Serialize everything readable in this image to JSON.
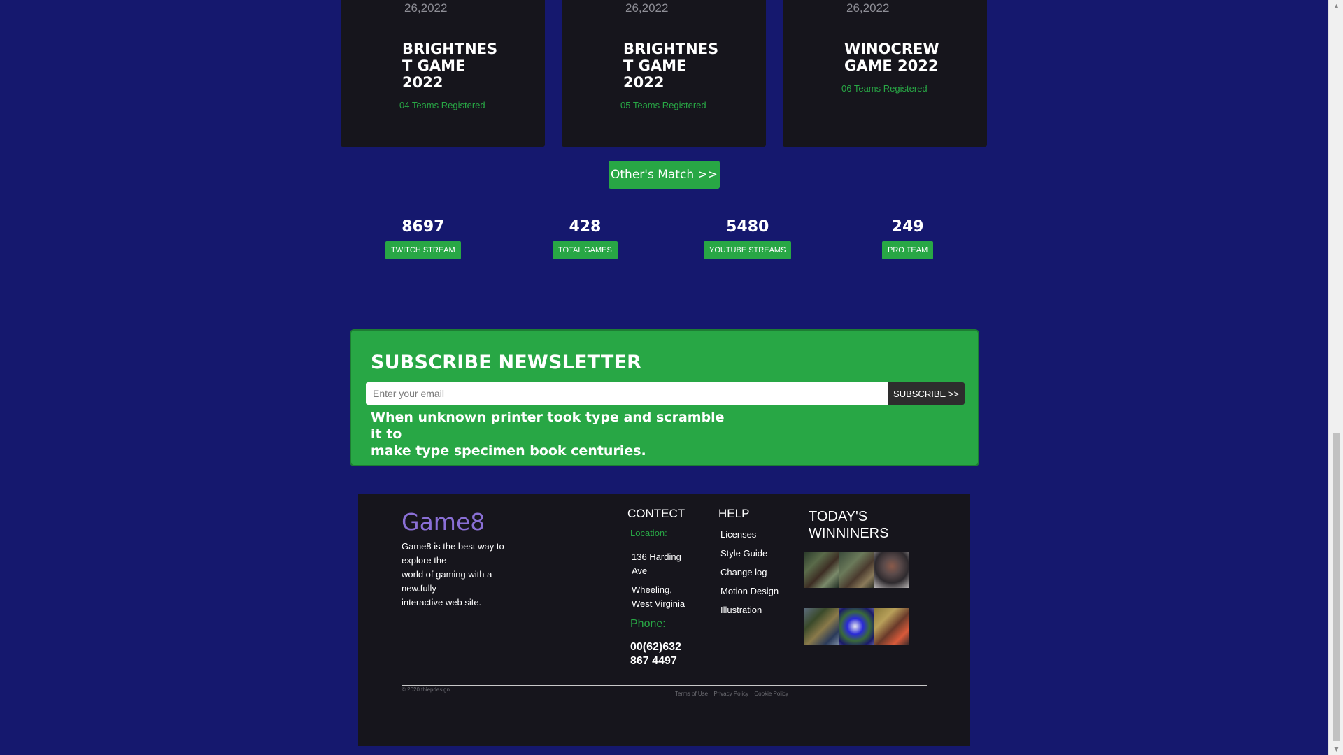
{
  "matches": [
    {
      "date": "26,2022",
      "title_lines": [
        "BRIGHTNES",
        "T GAME",
        "2022"
      ],
      "teams": "04 Teams Registered"
    },
    {
      "date": "26,2022",
      "title_lines": [
        "BRIGHTNES",
        "T GAME",
        "2022"
      ],
      "teams": "05 Teams Registered"
    },
    {
      "date": "26,2022",
      "title_lines": [
        "WINOCREW",
        "GAME 2022"
      ],
      "teams": "06 Teams Registered"
    }
  ],
  "others_button": "Other's Match >>",
  "stats": [
    {
      "value": "8697",
      "label": "TWITCH STREAM"
    },
    {
      "value": "428",
      "label": "TOTAL GAMES"
    },
    {
      "value": "5480",
      "label": "YOUTUBE STREAMS"
    },
    {
      "value": "249",
      "label": "PRO TEAM"
    }
  ],
  "newsletter": {
    "title": "SUBSCRIBE NEWSLETTER",
    "placeholder": "Enter your email",
    "button": "SUBSCRIBE >>",
    "text_lines": [
      "When unknown printer took type and scramble it to",
      "make type specimen book centuries."
    ]
  },
  "footer": {
    "brand": "Game8",
    "about_lines": [
      "Game8 is the best way to",
      "explore the",
      "world of gaming with a",
      "new.fully",
      "interactive web site."
    ],
    "contact_title": "CONTECT",
    "location_label": "Location:",
    "address_1": [
      "136 Harding",
      "Ave"
    ],
    "address_2": [
      "Wheeling,",
      "West Virginia"
    ],
    "phone_label": "Phone:",
    "phone_lines": [
      "00(62)632",
      "867 4497"
    ],
    "help_title": "HELP",
    "help_links": [
      "Licenses",
      "Style Guide",
      "Change log",
      "Motion Design",
      "Illustration"
    ],
    "winners_title_lines": [
      "TODAY'S",
      "WINNINERS"
    ],
    "copyright": "© 2020 thiepdesign",
    "legal_links": [
      "Terms of Use",
      "Privacy Policy",
      "Cookie Policy"
    ]
  },
  "colors": {
    "background": "#15186e",
    "card": "#16151c",
    "accent_green": "#28a745",
    "brand_purple": "#8a6fd6"
  }
}
